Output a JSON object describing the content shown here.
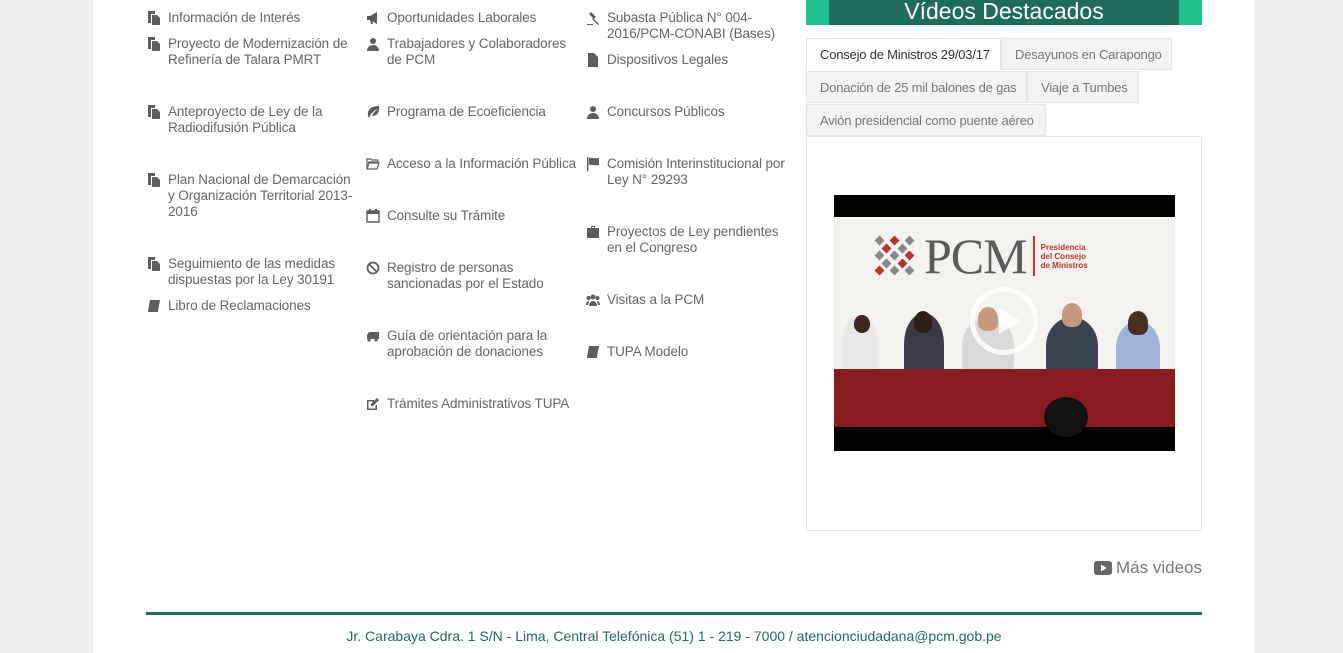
{
  "colors": {
    "accent": "#1ec08c",
    "brand": "#1f6c5b"
  },
  "links": {
    "col1": [
      {
        "label": "Información de Interés",
        "icon": "copy-icon"
      },
      {
        "label": "Proyecto de Modernización de Refinería de Talara PMRT",
        "icon": "copy-icon"
      },
      {
        "label": "Anteproyecto de Ley de la Radiodifusión Pública",
        "icon": "copy-icon"
      },
      {
        "label": "Plan Nacional de Demarcación y Organización Territorial 2013-2016",
        "icon": "copy-icon"
      },
      {
        "label": "Seguimiento de las medidas dispuestas por la Ley 30191",
        "icon": "copy-icon"
      },
      {
        "label": "Libro de Reclamaciones",
        "icon": "book-icon"
      }
    ],
    "col2": [
      {
        "label": "Oportunidades Laborales",
        "icon": "bullhorn-icon"
      },
      {
        "label": "Trabajadores y Colaboradores de PCM",
        "icon": "user-icon"
      },
      {
        "label": "Programa de Ecoeficiencia",
        "icon": "leaf-icon"
      },
      {
        "label": "Acceso a la Información Pública",
        "icon": "folder-open-icon"
      },
      {
        "label": "Consulte su Trámite",
        "icon": "calendar-icon"
      },
      {
        "label": "Registro de personas sancionadas por el Estado",
        "icon": "ban-icon"
      },
      {
        "label": "Guía de orientación para la aprobación de donaciones",
        "icon": "truck-icon"
      },
      {
        "label": "Trámites Administrativos TUPA",
        "icon": "edit-icon"
      }
    ],
    "col3": [
      {
        "label": "Subasta Pública N° 004-2016/PCM-CONABI (Bases)",
        "icon": "gavel-icon"
      },
      {
        "label": "Dispositivos Legales",
        "icon": "file-icon"
      },
      {
        "label": "Concursos Públicos",
        "icon": "user-icon"
      },
      {
        "label": "Comisión Interinstitucional por Ley N° 29293",
        "icon": "flag-icon"
      },
      {
        "label": "Proyectos de Ley pendientes en el Congreso",
        "icon": "briefcase-icon"
      },
      {
        "label": "Visitas a la PCM",
        "icon": "users-icon"
      },
      {
        "label": "TUPA Modelo",
        "icon": "book-icon"
      }
    ]
  },
  "videos": {
    "title": "Vídeos Destacados",
    "tabs": [
      "Consejo de Ministros 29/03/17",
      "Desayunos en Carapongo",
      "Donación de 25 mil balones de gas",
      "Viaje a Tumbes",
      "Avión presidencial como puente aéreo"
    ],
    "active_tab": 0,
    "video_logo_word": "PCM",
    "video_logo_sub": "Presidencia del Consejo de Ministros",
    "more_label": "Más videos"
  },
  "footer": {
    "address": "Jr. Carabaya Cdra. 1 S/N - Lima, Central Telefónica (51) 1 - 219 - 7000 / atencionciudadana@pcm.gob.pe"
  }
}
